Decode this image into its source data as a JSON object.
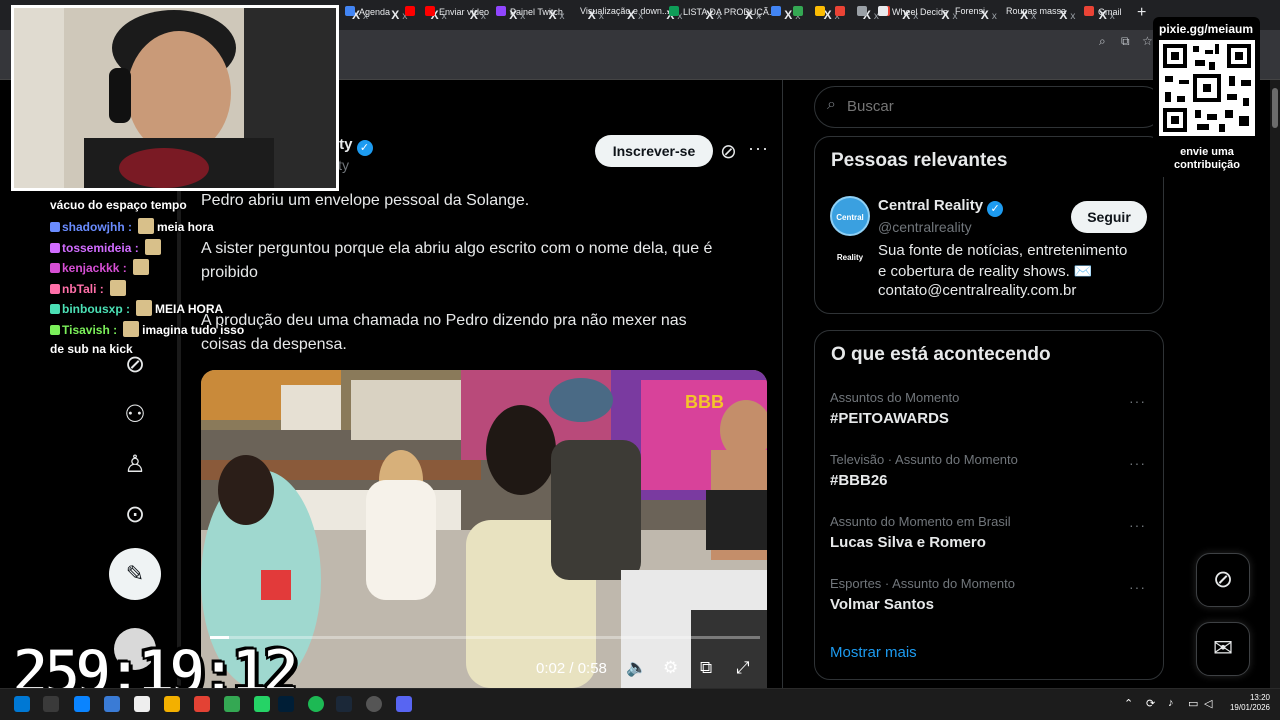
{
  "browser": {
    "tabs_label": "X",
    "tab_close": "x",
    "new_tab": "+",
    "bookmarks": [
      {
        "label": "Agenda",
        "color": "#4285f4"
      },
      {
        "label": "",
        "color": "#ff0000"
      },
      {
        "label": "Enviar vídeo",
        "color": "#ff0000"
      },
      {
        "label": "Painel Twitch",
        "color": "#9146ff"
      },
      {
        "label": "Visualização e down...",
        "color": ""
      },
      {
        "label": "LISTA DA PRODUÇÃ...",
        "color": "#0f9d58"
      },
      {
        "label": "",
        "color": "#4285f4"
      },
      {
        "label": "",
        "color": "#34a853"
      },
      {
        "label": "",
        "color": "#fbbc04"
      },
      {
        "label": "",
        "color": "#ea4335"
      },
      {
        "label": "",
        "color": "#9aa0a6"
      },
      {
        "label": "",
        "color": "#ea4335"
      },
      {
        "label": "Wheel Decide",
        "color": "#e8eaed"
      },
      {
        "label": "Forensi",
        "color": ""
      },
      {
        "label": "Roupas massa",
        "color": ""
      },
      {
        "label": "Gmail",
        "color": "#ea4335"
      }
    ]
  },
  "profile": {
    "name_fragment": "ity",
    "handle_fragment": "ity",
    "verified": "✓",
    "subscribe_label": "Inscrever-se"
  },
  "tweet": {
    "lines": [
      "Pedro abriu um envelope pessoal da Solange.",
      "A sister perguntou porque ela abriu algo escrito com o nome dela, que é",
      "proibido",
      "A produção deu uma chamada no Pedro dizendo pra não mexer nas",
      "coisas da despensa."
    ]
  },
  "video": {
    "time": "0:02 / 0:58",
    "progress": 0.034,
    "watermark": "BBB"
  },
  "sidebar": {
    "search_placeholder": "Buscar",
    "relevant": {
      "title": "Pessoas relevantes",
      "avatar_text": "Central Reality",
      "name": "Central Reality",
      "handle": "@centralreality",
      "follow_label": "Seguir",
      "bio": [
        "Sua fonte de notícias, entretenimento",
        "e cobertura de reality shows. ✉️",
        "contato@centralreality.com.br"
      ]
    },
    "trending": {
      "title": "O que está acontecendo",
      "items": [
        {
          "context": "Assuntos do Momento",
          "name": "#PEITOAWARDS"
        },
        {
          "context": "Televisão · Assunto do Momento",
          "name": "#BBB26"
        },
        {
          "context": "Assunto do Momento em Brasil",
          "name": "Lucas Silva e Romero"
        },
        {
          "context": "Esportes · Assunto do Momento",
          "name": "Volmar Santos"
        }
      ],
      "show_more": "Mostrar mais"
    }
  },
  "overlay": {
    "qr_url": "pixie.gg/meiaum",
    "qr_caption": "envie uma contribuição",
    "timer": "259:19:12",
    "chat": [
      {
        "user": "",
        "text": "vácuo do espaço tempo",
        "color": "#ffffff"
      },
      {
        "user": "shadowjhh :",
        "text": "meia hora",
        "color": "#6a8cff"
      },
      {
        "user": "tossemideia :",
        "text": "",
        "color": "#d16cff"
      },
      {
        "user": "kenjackkk :",
        "text": "",
        "color": "#d64fd4"
      },
      {
        "user": "nbTali :",
        "text": "",
        "color": "#ff6fa8"
      },
      {
        "user": "binbousxp :",
        "text": "MEIA HORA",
        "color": "#4be0b5"
      },
      {
        "user": "Tisavish :",
        "text": "imagina tudo isso",
        "color": "#7bf05a"
      },
      {
        "user": "",
        "text": "de sub na kick",
        "color": "#ffffff"
      }
    ]
  },
  "taskbar": {
    "time": "13:20",
    "date": "19/01/2026"
  }
}
